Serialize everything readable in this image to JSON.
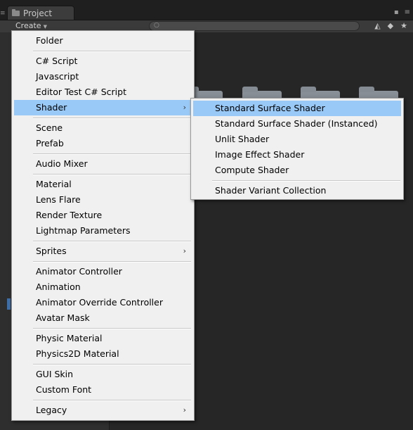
{
  "window": {
    "tab_title": "Project",
    "create_label": "Create"
  },
  "create_menu": {
    "items": [
      {
        "label": "Folder"
      },
      {
        "label": "C# Script"
      },
      {
        "label": "Javascript"
      },
      {
        "label": "Editor Test C# Script"
      },
      {
        "label": "Shader",
        "submenu": true,
        "highlighted": true
      },
      {
        "label": "Scene"
      },
      {
        "label": "Prefab"
      },
      {
        "label": "Audio Mixer"
      },
      {
        "label": "Material"
      },
      {
        "label": "Lens Flare"
      },
      {
        "label": "Render Texture"
      },
      {
        "label": "Lightmap Parameters"
      },
      {
        "label": "Sprites",
        "submenu": true
      },
      {
        "label": "Animator Controller"
      },
      {
        "label": "Animation"
      },
      {
        "label": "Animator Override Controller"
      },
      {
        "label": "Avatar Mask"
      },
      {
        "label": "Physic Material"
      },
      {
        "label": "Physics2D Material"
      },
      {
        "label": "GUI Skin"
      },
      {
        "label": "Custom Font"
      },
      {
        "label": "Legacy",
        "submenu": true
      }
    ],
    "submenu_arrow": "›"
  },
  "shader_submenu": {
    "items": [
      {
        "label": "Standard Surface Shader",
        "highlighted": true
      },
      {
        "label": "Standard Surface Shader (Instanced)"
      },
      {
        "label": "Unlit Shader"
      },
      {
        "label": "Image Effect Shader"
      },
      {
        "label": "Compute Shader"
      },
      {
        "label": "Shader Variant Collection"
      }
    ]
  },
  "colors": {
    "menu_bg": "#f0f0f0",
    "highlight": "#99c9f7",
    "editor_bg": "#262626"
  }
}
